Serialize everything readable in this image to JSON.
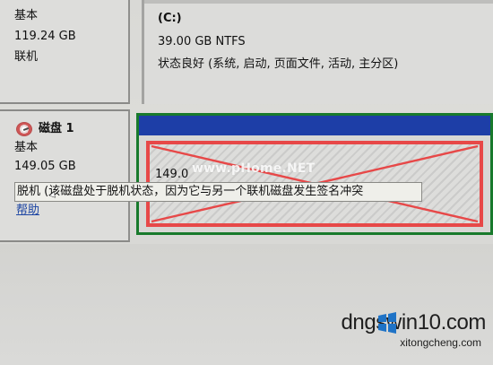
{
  "disk0": {
    "type": "基本",
    "size": "119.24 GB",
    "status": "联机"
  },
  "partition0": {
    "drive": "(C:)",
    "size_fs": "39.00 GB NTFS",
    "health": "状态良好 (系统, 启动, 页面文件, 活动, 主分区)"
  },
  "disk1": {
    "name": "磁盘 1",
    "type": "基本",
    "size": "149.05 GB",
    "help": "帮助"
  },
  "partition1": {
    "size_text": "149.0"
  },
  "tooltip": {
    "text": "脱机 (该磁盘处于脱机状态，因为它与另一个联机磁盘发生签名冲突"
  },
  "watermark": {
    "center": "www.pHome.NET"
  },
  "branding": {
    "main": "dngswin10.com",
    "sub": "xitongcheng.com"
  },
  "colors": {
    "accent_red": "#e74848",
    "accent_blue": "#1d3ea7",
    "accent_green": "#187a2c"
  }
}
